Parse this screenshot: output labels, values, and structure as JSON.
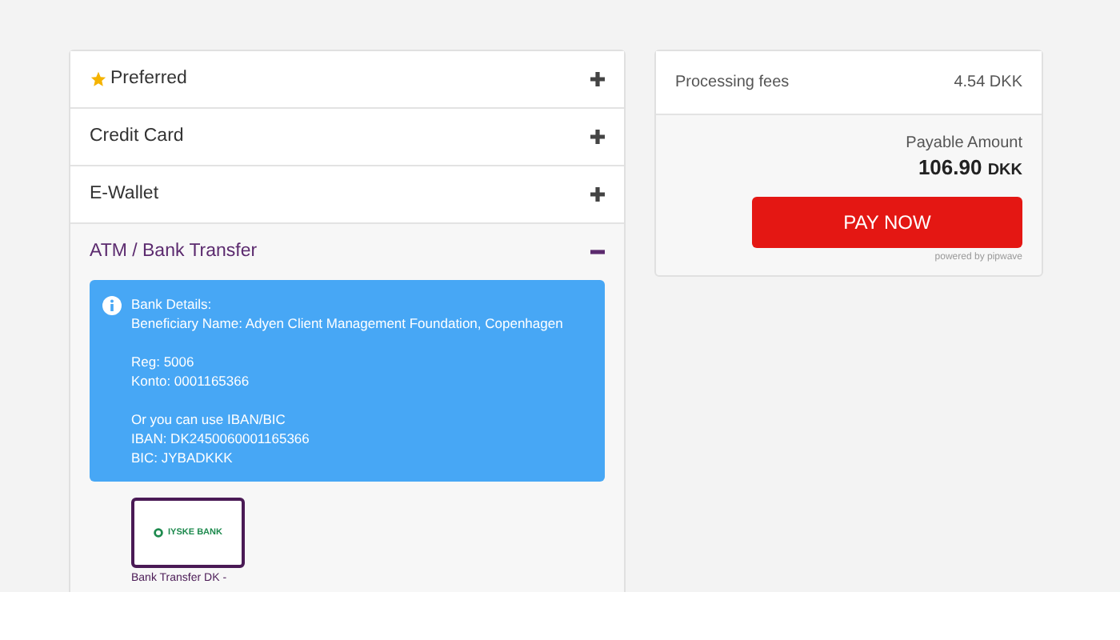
{
  "sections": [
    {
      "label": "Preferred",
      "starred": true,
      "expanded": false
    },
    {
      "label": "Credit Card",
      "starred": false,
      "expanded": false
    },
    {
      "label": "E-Wallet",
      "starred": false,
      "expanded": false
    },
    {
      "label": "ATM / Bank Transfer",
      "starred": false,
      "expanded": true
    }
  ],
  "bank_details": {
    "paragraphs": [
      [
        "Bank Details:",
        "Beneficiary Name: Adyen Client Management Foundation, Copenhagen"
      ],
      [
        "Reg: 5006",
        "Konto: 0001165366"
      ],
      [
        "Or you can use IBAN/BIC",
        "IBAN: DK2450060001165366",
        "BIC: JYBADKKK"
      ]
    ]
  },
  "bank_option": {
    "logo_text": "IYSKE BANK",
    "caption": "Bank Transfer DK -",
    "selected": true
  },
  "summary": {
    "fees_label": "Processing fees",
    "fees_value": "4.54 DKK",
    "payable_label": "Payable Amount",
    "amount": "106.90",
    "currency": "DKK",
    "pay_button": "PAY NOW",
    "powered_by": "powered by pipwave"
  }
}
